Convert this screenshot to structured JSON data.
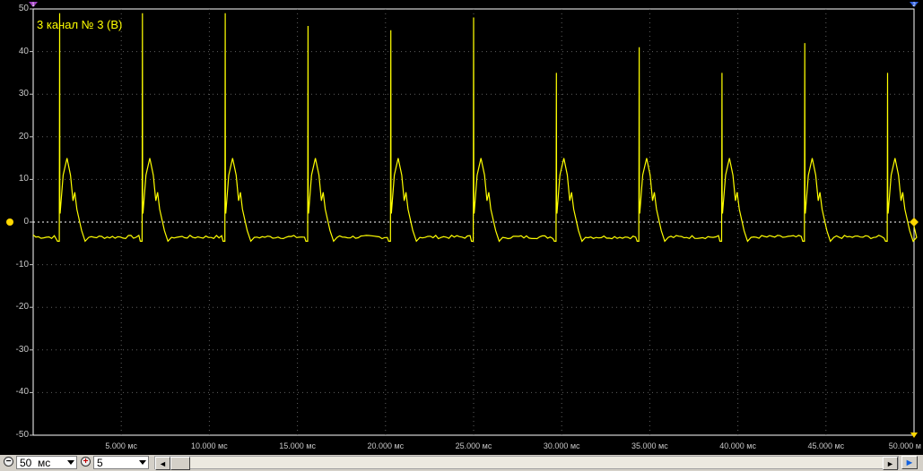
{
  "channel_label": "3  канал № 3 (В)",
  "colors": {
    "trace": "#ffff00",
    "grid": "#606060",
    "background": "#000000",
    "frame": "#ffffff"
  },
  "y_ticks": [
    "50",
    "40",
    "30",
    "20",
    "10",
    "0",
    "-10",
    "-20",
    "-30",
    "-40",
    "-50"
  ],
  "x_ticks": [
    "5.000 мс",
    "10.000 мс",
    "15.000 мс",
    "20.000 мс",
    "25.000 мс",
    "30.000 мс",
    "35.000 мс",
    "40.000 мс",
    "45.000 мс",
    "50.000 м"
  ],
  "markers": {
    "left_top": "1",
    "right_top": "2"
  },
  "toolbar": {
    "zoom_out_icon": "zoom-out-icon",
    "timebase": "50  мс",
    "zoom_in_icon": "zoom-in-icon",
    "zoom_factor": "5",
    "scroll_left": "◄",
    "scroll_right": "►"
  },
  "chart_data": {
    "type": "line",
    "xlabel": "",
    "ylabel": "",
    "xlim": [
      0,
      50000
    ],
    "ylim": [
      -50,
      50
    ],
    "x_unit": "мс",
    "y_unit": "В",
    "grid": true,
    "series": [
      {
        "name": "3  канал № 3 (В)",
        "period": 4700,
        "first_spike_x": 1500,
        "spike_peaks": [
          49,
          49,
          49,
          46,
          45,
          48,
          35,
          41,
          35,
          42,
          35
        ],
        "secondary_peak": 15,
        "shoulder_peak": 7,
        "baseline": -3.5,
        "trough": -4.5
      }
    ]
  }
}
